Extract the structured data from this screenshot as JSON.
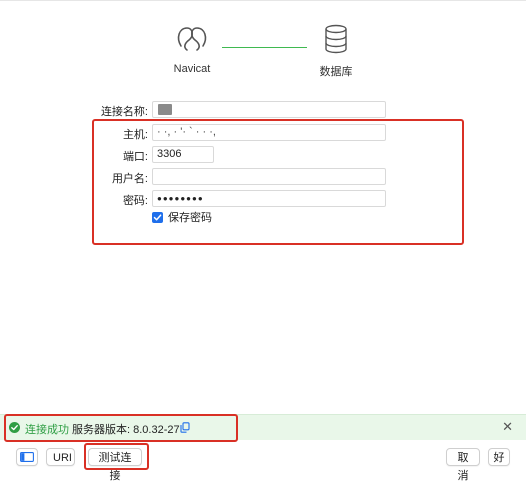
{
  "flow": {
    "source_label": "Navicat",
    "target_label": "数据库"
  },
  "form": {
    "conn_name_label": "连接名称:",
    "host_label": "主机:",
    "host_value": "· ·, ·  '·  `  ·  ·  ·,",
    "port_label": "端口:",
    "port_value": "3306",
    "user_label": "用户名:",
    "user_value": "",
    "password_label": "密码:",
    "password_value": "●●●●●●●●",
    "save_password_label": "保存密码",
    "save_password_checked": true
  },
  "status": {
    "success_text": "连接成功",
    "server_version_text": "服务器版本: 8.0.32-27",
    "color_success": "#2f9e44"
  },
  "footer": {
    "uri_label": "URI",
    "test_label": "测试连接",
    "cancel_label": "取消",
    "ok_label": "好"
  },
  "colors": {
    "accent": "#1f6feb",
    "highlight": "#d93025",
    "connector": "#3fb950"
  }
}
